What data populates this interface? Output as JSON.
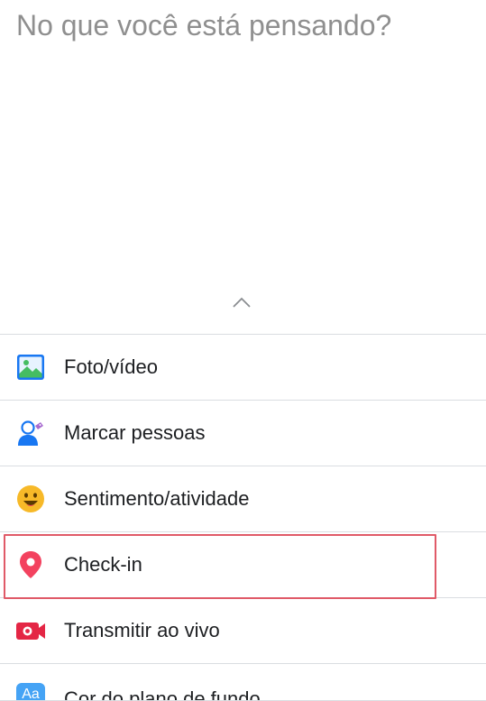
{
  "composer": {
    "placeholder": "No que você está pensando?"
  },
  "options": [
    {
      "label": "Foto/vídeo",
      "icon": "photo-icon"
    },
    {
      "label": "Marcar pessoas",
      "icon": "tag-people-icon"
    },
    {
      "label": "Sentimento/atividade",
      "icon": "smiley-icon"
    },
    {
      "label": "Check-in",
      "icon": "location-pin-icon"
    },
    {
      "label": "Transmitir ao vivo",
      "icon": "live-video-icon"
    },
    {
      "label": "Cor do plano de fundo",
      "icon": "background-color-icon",
      "icon_text": "Aa"
    }
  ],
  "colors": {
    "photo_green": "#45bd62",
    "photo_blue": "#1877f2",
    "smiley_yellow": "#f7b928",
    "checkin_red": "#f3425f",
    "live_red": "#e42645",
    "highlight_border": "#e05a68"
  }
}
